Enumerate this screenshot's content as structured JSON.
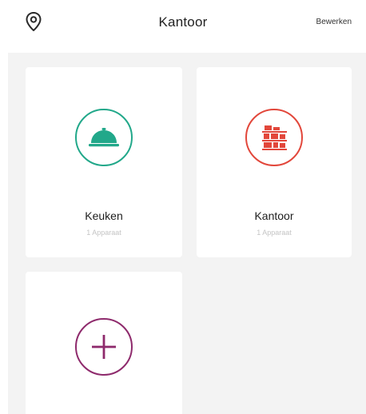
{
  "header": {
    "location_icon": "location-pin-icon",
    "title": "Kantoor",
    "edit_label": "Bewerken"
  },
  "rooms": [
    {
      "name": "Keuken",
      "subtitle": "1 Apparaat",
      "icon": "cloche-icon",
      "color": "#22a88a"
    },
    {
      "name": "Kantoor",
      "subtitle": "1 Apparaat",
      "icon": "office-shelves-icon",
      "color": "#e2473b"
    }
  ],
  "add_room": {
    "icon": "plus-icon",
    "color": "#8e2a6c"
  }
}
